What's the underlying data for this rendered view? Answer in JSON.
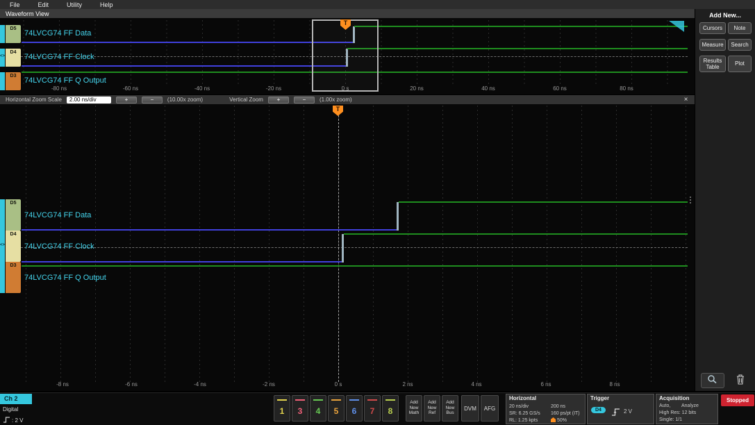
{
  "colors": {
    "accent": "#35c7de",
    "label": "#45d6ef",
    "wf_low": "#4040dd",
    "wf_high": "#1e8e1e",
    "edge": "#9fb4c0",
    "trigger": "#ff8f1f",
    "stopped": "#cf2330"
  },
  "icons": {
    "close": "×",
    "plus": "+",
    "minus": "−",
    "grip": "<>",
    "trigger_flag": "T"
  },
  "menu": {
    "items": [
      "File",
      "Edit",
      "Utility",
      "Help"
    ]
  },
  "view_title": "Waveform View",
  "channels": [
    {
      "id": "D5",
      "label": "74LVCG74 FF Data",
      "color": "#a9bf85"
    },
    {
      "id": "D4",
      "label": "74LVCG74 FF Clock",
      "color": "#e6dfa3"
    },
    {
      "id": "D3",
      "label": "74LVCG74 FF Q Output",
      "color": "#d07c33"
    }
  ],
  "overview": {
    "ticks": [
      "-80 ns",
      "-60 ns",
      "-40 ns",
      "-20 ns",
      "0 s",
      "20 ns",
      "40 ns",
      "60 ns",
      "80 ns"
    ]
  },
  "zoom_toolbar": {
    "h_label": "Horizontal Zoom Scale",
    "h_value": "2.00 ns/div",
    "h_zoom": "(10.00x zoom)",
    "v_label": "Vertical Zoom",
    "v_zoom": "(1.00x zoom)"
  },
  "main_view": {
    "ticks": [
      "-8 ns",
      "-6 ns",
      "-4 ns",
      "-2 ns",
      "0 s",
      "2 ns",
      "4 ns",
      "6 ns",
      "8 ns"
    ]
  },
  "sidebar": {
    "title": "Add New...",
    "buttons": [
      "Cursors",
      "Note",
      "Measure",
      "Search",
      "Results Table",
      "Plot"
    ]
  },
  "bottom": {
    "channel_badge": {
      "name": "Ch 2",
      "type": "Digital",
      "threshold": ": 2 V"
    },
    "channel_buttons": [
      {
        "n": "1",
        "color": "#e3d44d"
      },
      {
        "n": "3",
        "color": "#ef6078"
      },
      {
        "n": "4",
        "color": "#67c953"
      },
      {
        "n": "5",
        "color": "#e8a23c"
      },
      {
        "n": "6",
        "color": "#5f8fe8"
      },
      {
        "n": "7",
        "color": "#d14b4b"
      },
      {
        "n": "8",
        "color": "#b9cf4f"
      }
    ],
    "add_buttons": [
      [
        "Add",
        "New",
        "Math"
      ],
      [
        "Add",
        "New",
        "Ref"
      ],
      [
        "Add",
        "New",
        "Bus"
      ]
    ],
    "dvm": "DVM",
    "afg": "AFG",
    "horizontal": {
      "title": "Horizontal",
      "scale": "20 ns/div",
      "window": "200 ns",
      "sample_rate": "SR: 6.25 GS/s",
      "resolution": "160 ps/pt (IT)",
      "record_length": "RL: 1.25 kpts",
      "position": "50%"
    },
    "trigger": {
      "title": "Trigger",
      "source": "D4",
      "level": "2 V"
    },
    "acquisition": {
      "title": "Acquisition",
      "mode": "Auto,",
      "analyze": "Analyze",
      "res": "High Res: 12 bits",
      "single": "Single: 1/1"
    },
    "status": "Stopped"
  }
}
